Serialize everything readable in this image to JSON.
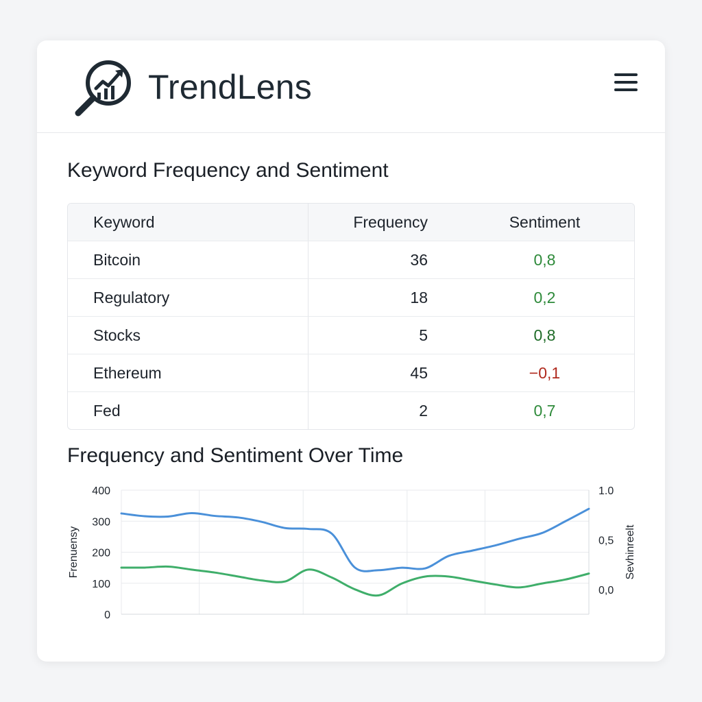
{
  "app": {
    "title": "TrendLens",
    "logo_icon": "magnifier-trend-chart-icon",
    "menu_icon": "hamburger-menu-icon"
  },
  "table_section": {
    "title": "Keyword Frequency and Sentiment",
    "headers": {
      "keyword": "Keyword",
      "frequency": "Frequency",
      "sentiment": "Sentiment"
    },
    "rows": [
      {
        "keyword": "Bitcoin",
        "frequency": "36",
        "sentiment": "0,8"
      },
      {
        "keyword": "Regulatory",
        "frequency": "18",
        "sentiment": "0,2"
      },
      {
        "keyword": "Stocks",
        "frequency": "5",
        "sentiment": "0,8"
      },
      {
        "keyword": "Ethereum",
        "frequency": "45",
        "sentiment": "−0,1"
      },
      {
        "keyword": "Fed",
        "frequency": "2",
        "sentiment": "0,7"
      }
    ]
  },
  "chart_section": {
    "title": "Frequency and Sentiment Over Time"
  },
  "colors": {
    "positive": "#2e8a3a",
    "positive_strong": "#1e6b27",
    "negative": "#b02a1e",
    "frequency_line": "#4a90d9",
    "sentiment_line": "#3fae6a"
  },
  "chart_data": {
    "type": "line",
    "title": "Frequency and Sentiment Over Time",
    "ylabel": "Frenuensy",
    "y2label": "Sevhinreelt",
    "ylim": [
      0,
      400
    ],
    "y2lim": [
      -0.25,
      1.0
    ],
    "yticks": [
      "0",
      "100",
      "200",
      "300",
      "400"
    ],
    "y2ticks": [
      "0,0",
      "0,5",
      "1.0"
    ],
    "y2tick_values": [
      0,
      0.5,
      1.0
    ],
    "x": [
      0,
      1,
      2,
      3,
      4,
      5,
      6,
      7,
      8,
      9,
      10,
      11,
      12,
      13,
      14,
      15,
      16,
      17,
      18,
      19,
      20
    ],
    "grid": true,
    "legend": "none",
    "series": [
      {
        "axis": "left",
        "color": "#4a90d9",
        "values": [
          325,
          316,
          315,
          326,
          317,
          312,
          298,
          278,
          275,
          260,
          150,
          142,
          150,
          148,
          188,
          205,
          222,
          243,
          262,
          300,
          340
        ]
      },
      {
        "axis": "right",
        "color": "#3fae6a",
        "values": [
          0.22,
          0.22,
          0.23,
          0.2,
          0.17,
          0.13,
          0.09,
          0.08,
          0.2,
          0.12,
          0.0,
          -0.06,
          0.06,
          0.13,
          0.13,
          0.09,
          0.05,
          0.02,
          0.06,
          0.1,
          0.16
        ]
      }
    ]
  }
}
